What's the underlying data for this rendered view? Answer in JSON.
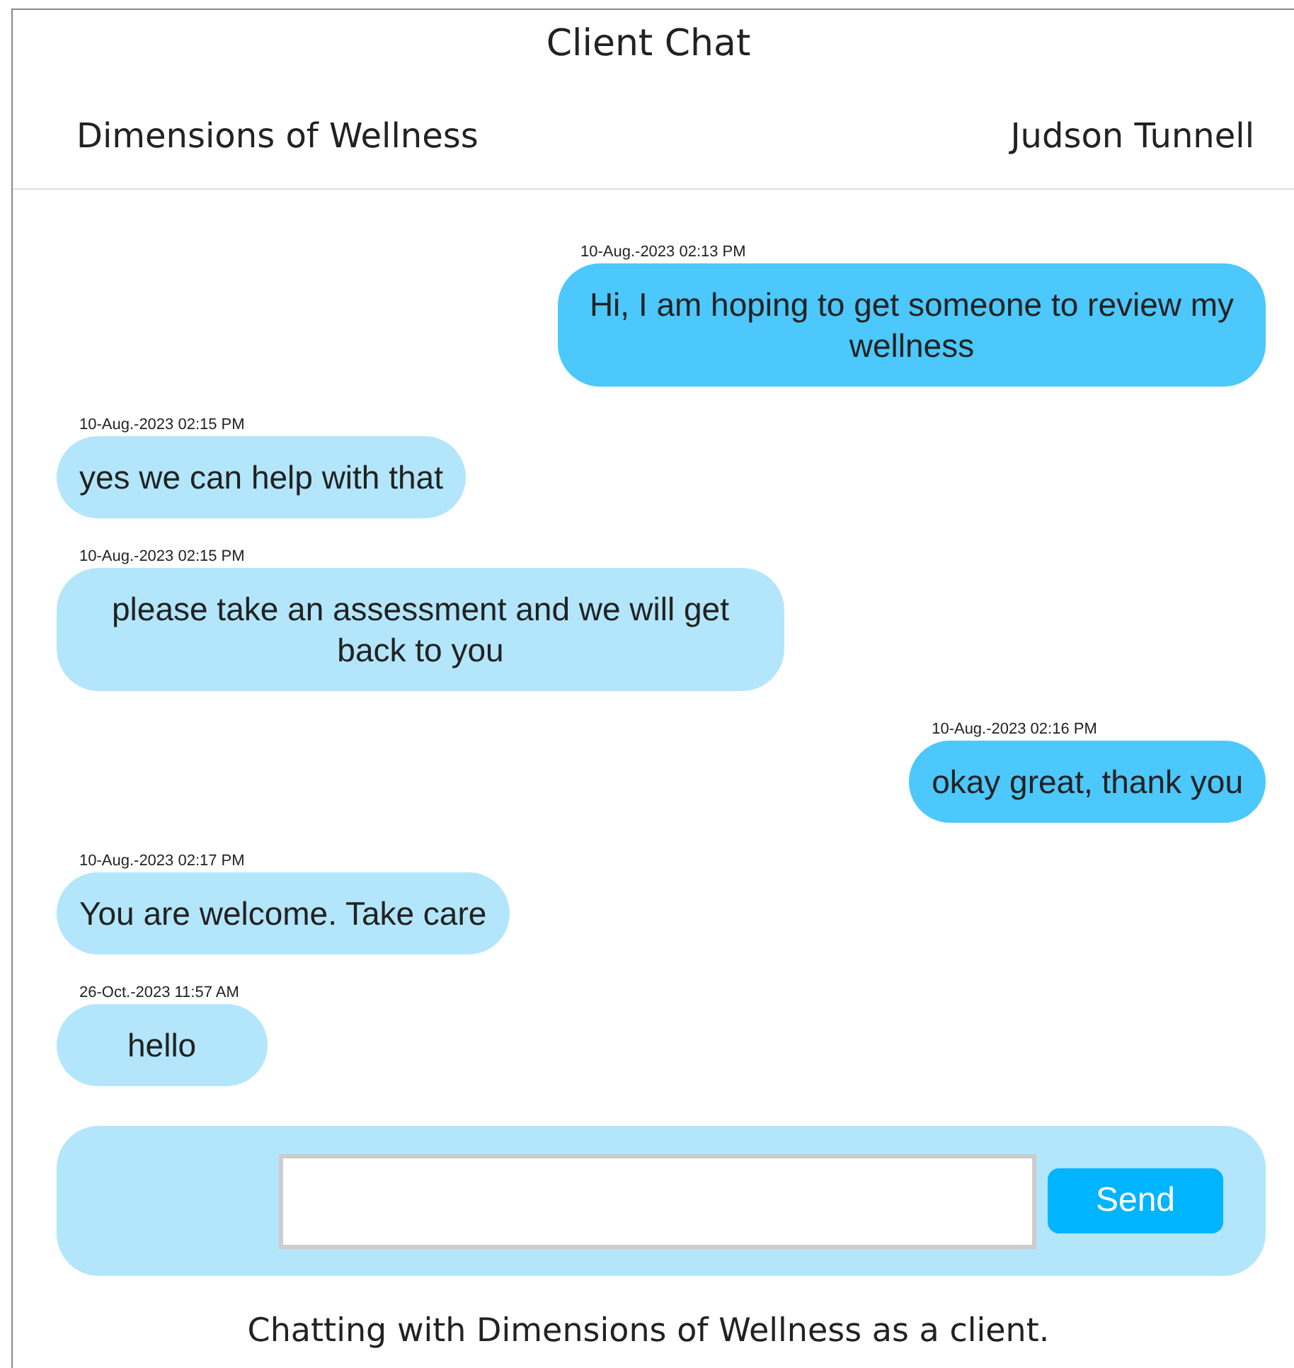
{
  "header": {
    "title": "Client Chat",
    "organization": "Dimensions of Wellness",
    "client": "Judson Tunnell"
  },
  "messages": [
    {
      "kind": "sent",
      "time": "10-Aug.-2023 02:13 PM",
      "text": "Hi, I am hoping to get someone to review my wellness"
    },
    {
      "kind": "received",
      "time": "10-Aug.-2023 02:15 PM",
      "text": "yes we can help with that"
    },
    {
      "kind": "received",
      "time": "10-Aug.-2023 02:15 PM",
      "text": "please take an assessment and we will get back to you"
    },
    {
      "kind": "sent",
      "time": "10-Aug.-2023 02:16 PM",
      "text": "okay great, thank you"
    },
    {
      "kind": "received",
      "time": "10-Aug.-2023 02:17 PM",
      "text": "You are welcome. Take care"
    },
    {
      "kind": "received",
      "time": "26-Oct.-2023 11:57 AM",
      "text": "hello"
    }
  ],
  "composer": {
    "send_button": "Send"
  },
  "footer": "Chatting with Dimensions of Wellness as a client."
}
